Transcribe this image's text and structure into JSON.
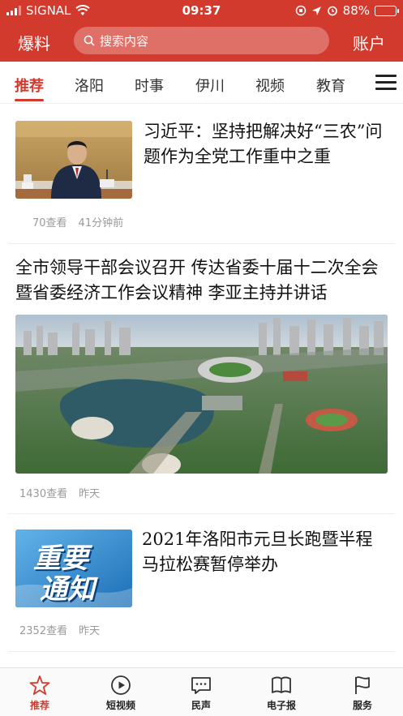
{
  "status_bar": {
    "carrier": "SIGNAL",
    "time": "09:37",
    "battery": "88%",
    "battery_level": 0.88
  },
  "header": {
    "left_label": "爆料",
    "search_placeholder": "搜索内容",
    "right_label": "账户"
  },
  "channels": [
    "推荐",
    "洛阳",
    "时事",
    "伊川",
    "视频",
    "教育"
  ],
  "active_channel": 0,
  "news": [
    {
      "title": "习近平：坚持把解决好“三农”问题作为全党工作重中之重",
      "views": "70查看",
      "time": "41分钟前"
    },
    {
      "title": "全市领导干部会议召开 传达省委十届十二次全会暨省委经济工作会议精神 李亚主持并讲话",
      "views": "1430查看",
      "time": "昨天"
    },
    {
      "title": "2021年洛阳市元旦长跑暨半程马拉松赛暂停举办",
      "views": "2352查看",
      "time": "昨天",
      "image_text_1": "重要",
      "image_text_2": "通知"
    }
  ],
  "tabbar": [
    "推荐",
    "短视频",
    "民声",
    "电子报",
    "服务"
  ],
  "colors": {
    "brand_red": "#d23a2e"
  }
}
